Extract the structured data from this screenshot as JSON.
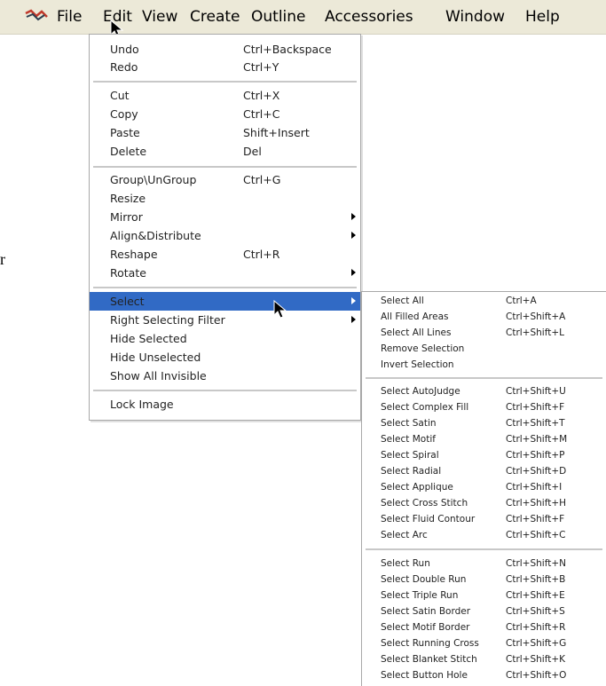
{
  "menubar": {
    "items": [
      "File",
      "Edit",
      "View",
      "Create",
      "Outline",
      "Accessories",
      "Window",
      "Help"
    ]
  },
  "stray_text": "r",
  "edit_menu": {
    "items": [
      {
        "label": "Undo",
        "shortcut": "Ctrl+Backspace"
      },
      {
        "label": "Redo",
        "shortcut": "Ctrl+Y",
        "disabled": true
      },
      {
        "label": "Cut",
        "shortcut": "Ctrl+X"
      },
      {
        "label": "Copy",
        "shortcut": "Ctrl+C"
      },
      {
        "label": "Paste",
        "shortcut": "Shift+Insert",
        "disabled": true
      },
      {
        "label": "Delete",
        "shortcut": "Del"
      },
      {
        "label": "Group\\UnGroup",
        "shortcut": "Ctrl+G"
      },
      {
        "label": "Resize",
        "shortcut": ""
      },
      {
        "label": "Mirror",
        "shortcut": "",
        "submenu": true
      },
      {
        "label": "Align&Distribute",
        "shortcut": "",
        "submenu": true
      },
      {
        "label": "Reshape",
        "shortcut": "Ctrl+R"
      },
      {
        "label": "Rotate",
        "shortcut": "",
        "submenu": true
      },
      {
        "label": "Select",
        "shortcut": "",
        "submenu": true,
        "highlighted": true
      },
      {
        "label": "Right Selecting Filter",
        "shortcut": "",
        "submenu": true
      },
      {
        "label": "Hide Selected",
        "shortcut": ""
      },
      {
        "label": "Hide Unselected",
        "shortcut": ""
      },
      {
        "label": "Show All Invisible",
        "shortcut": ""
      },
      {
        "label": "Lock Image",
        "shortcut": ""
      }
    ]
  },
  "select_submenu": {
    "items": [
      {
        "label": "Select All",
        "shortcut": "Ctrl+A"
      },
      {
        "label": "All Filled Areas",
        "shortcut": "Ctrl+Shift+A"
      },
      {
        "label": "Select All Lines",
        "shortcut": "Ctrl+Shift+L"
      },
      {
        "label": "Remove Selection",
        "shortcut": ""
      },
      {
        "label": "Invert Selection",
        "shortcut": ""
      },
      {
        "label": "Select AutoJudge",
        "shortcut": "Ctrl+Shift+U"
      },
      {
        "label": "Select Complex Fill",
        "shortcut": "Ctrl+Shift+F"
      },
      {
        "label": "Select Satin",
        "shortcut": "Ctrl+Shift+T"
      },
      {
        "label": "Select Motif",
        "shortcut": "Ctrl+Shift+M"
      },
      {
        "label": "Select Spiral",
        "shortcut": "Ctrl+Shift+P"
      },
      {
        "label": "Select Radial",
        "shortcut": "Ctrl+Shift+D"
      },
      {
        "label": "Select Applique",
        "shortcut": "Ctrl+Shift+I"
      },
      {
        "label": "Select Cross Stitch",
        "shortcut": "Ctrl+Shift+H"
      },
      {
        "label": "Select Fluid Contour",
        "shortcut": "Ctrl+Shift+F"
      },
      {
        "label": "Select Arc",
        "shortcut": "Ctrl+Shift+C"
      },
      {
        "label": "Select Run",
        "shortcut": "Ctrl+Shift+N"
      },
      {
        "label": "Select Double Run",
        "shortcut": "Ctrl+Shift+B"
      },
      {
        "label": "Select Triple Run",
        "shortcut": "Ctrl+Shift+E"
      },
      {
        "label": "Select Satin Border",
        "shortcut": "Ctrl+Shift+S"
      },
      {
        "label": "Select Motif Border",
        "shortcut": "Ctrl+Shift+R"
      },
      {
        "label": "Select Running Cross",
        "shortcut": "Ctrl+Shift+G"
      },
      {
        "label": "Select Blanket Stitch",
        "shortcut": "Ctrl+Shift+K"
      },
      {
        "label": "Select Button Hole",
        "shortcut": "Ctrl+Shift+O"
      }
    ]
  }
}
